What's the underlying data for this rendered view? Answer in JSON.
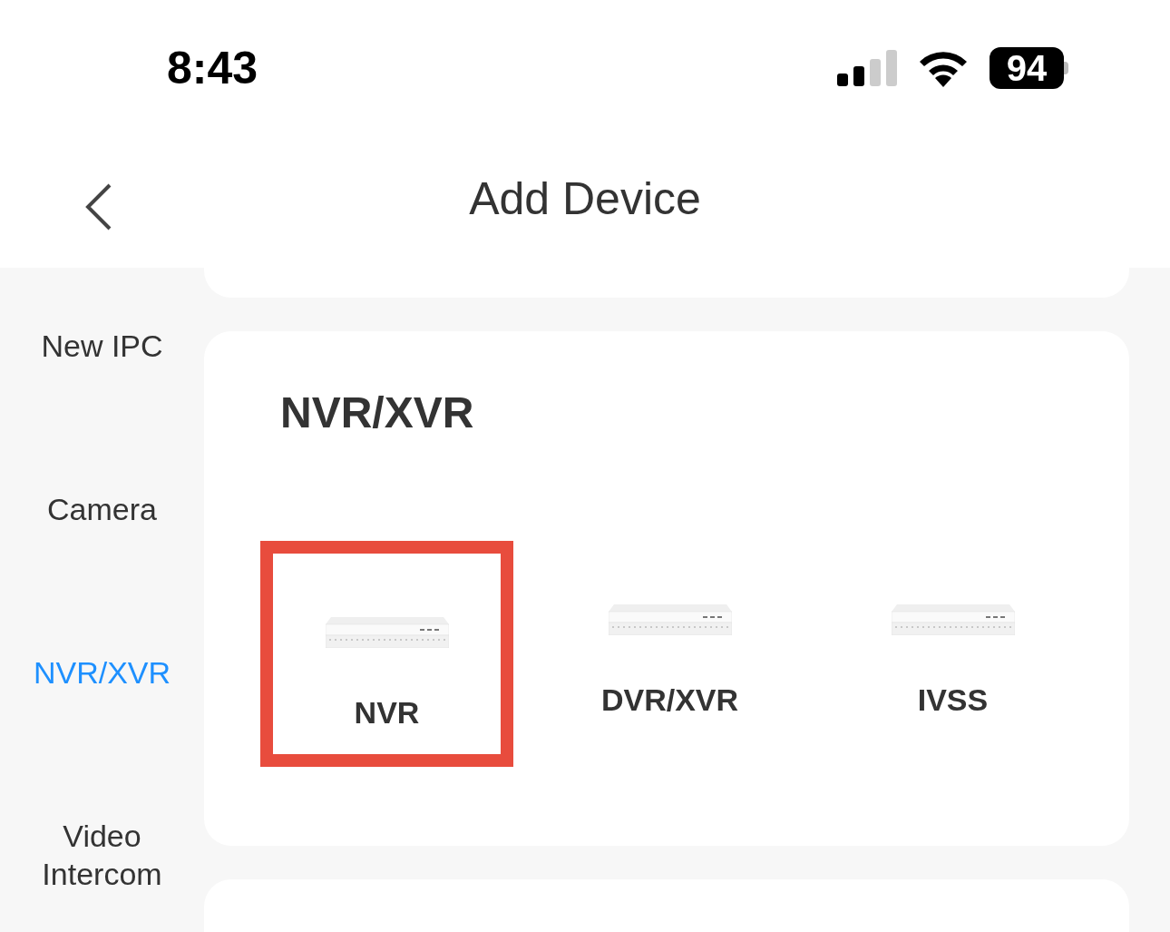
{
  "status_bar": {
    "time": "8:43",
    "battery": "94"
  },
  "header": {
    "title": "Add Device"
  },
  "sidebar": {
    "items": [
      {
        "label": "New IPC",
        "selected": false
      },
      {
        "label": "Camera",
        "selected": false
      },
      {
        "label": "NVR/XVR",
        "selected": true
      },
      {
        "label": "Video Intercom",
        "selected": false
      }
    ]
  },
  "section": {
    "title": "NVR/XVR",
    "devices": [
      {
        "label": "NVR",
        "highlighted": true
      },
      {
        "label": "DVR/XVR",
        "highlighted": false
      },
      {
        "label": "IVSS",
        "highlighted": false
      }
    ]
  }
}
